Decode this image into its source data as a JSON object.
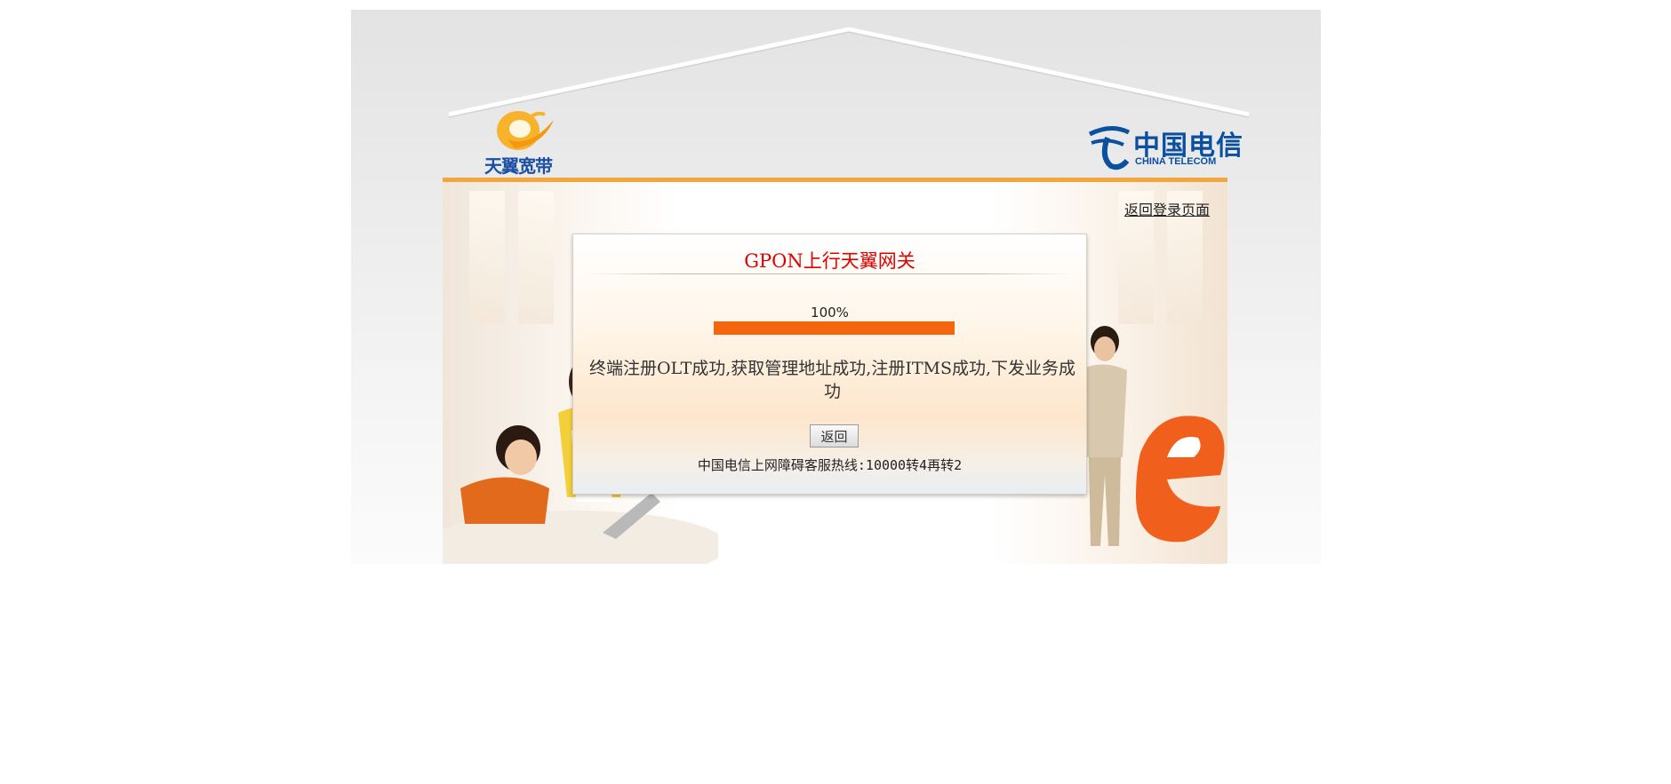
{
  "brand": {
    "tianyi_logo_text": "天翼宽带",
    "china_telecom_cn": "中国电信",
    "china_telecom_en": "CHINA TELECOM"
  },
  "links": {
    "return_login": "返回登录页面"
  },
  "dialog": {
    "title": "GPON上行天翼网关",
    "progress_label": "100%",
    "progress_value": 1.0,
    "status_message": "终端注册OLT成功,获取管理地址成功,注册ITMS成功,下发业务成功",
    "back_button": "返回",
    "hotline": "中国电信上网障碍客服热线:10000转4再转2"
  },
  "colors": {
    "accent_orange": "#f5650d",
    "title_red": "#e00000",
    "telecom_blue": "#0a4fa0",
    "header_bar": "#f3a53e"
  }
}
